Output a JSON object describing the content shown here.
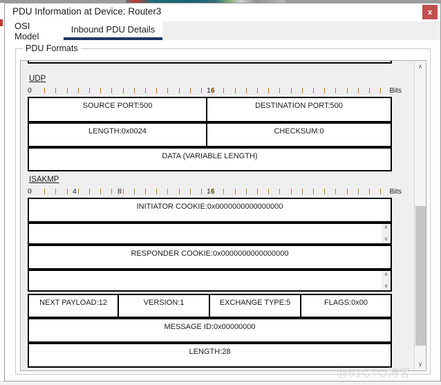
{
  "window": {
    "title": "PDU Information at Device: Router3",
    "close_label": "x",
    "close_color": "#c0504d"
  },
  "tabs": [
    {
      "label": "OSI Model",
      "active": false
    },
    {
      "label": "Inbound PDU Details",
      "active": true
    }
  ],
  "groupbox": {
    "label": "PDU Formats"
  },
  "scrollbar": {
    "up_arrow": "∧",
    "down_arrow": "∨"
  },
  "udp": {
    "label": "UDP",
    "ruler": {
      "marks": [
        "0",
        "16"
      ],
      "unit": "Bits"
    },
    "rows": [
      [
        "SOURCE PORT:500",
        "DESTINATION PORT:500"
      ],
      [
        "LENGTH:0x0024",
        "CHECKSUM:0"
      ],
      [
        "DATA (VARIABLE LENGTH)"
      ]
    ]
  },
  "isakmp": {
    "label": "ISAKMP",
    "ruler": {
      "marks": [
        "0",
        "4",
        "8",
        "16"
      ],
      "unit": "Bits"
    },
    "initiator_cookie": "INITIATOR COOKIE:0x0000000000000000",
    "responder_cookie": "RESPONDER COOKIE:0x0000000000000000",
    "header_row": [
      "NEXT PAYLOAD:12",
      "VERSION:1",
      "EXCHANGE TYPE:5",
      "FLAGS:0x00"
    ],
    "message_id": "MESSAGE ID:0x00000000",
    "length": "LENGTH:28",
    "spinner": {
      "up": "∧",
      "down": "∨"
    }
  },
  "watermark": "@51CTO博客"
}
